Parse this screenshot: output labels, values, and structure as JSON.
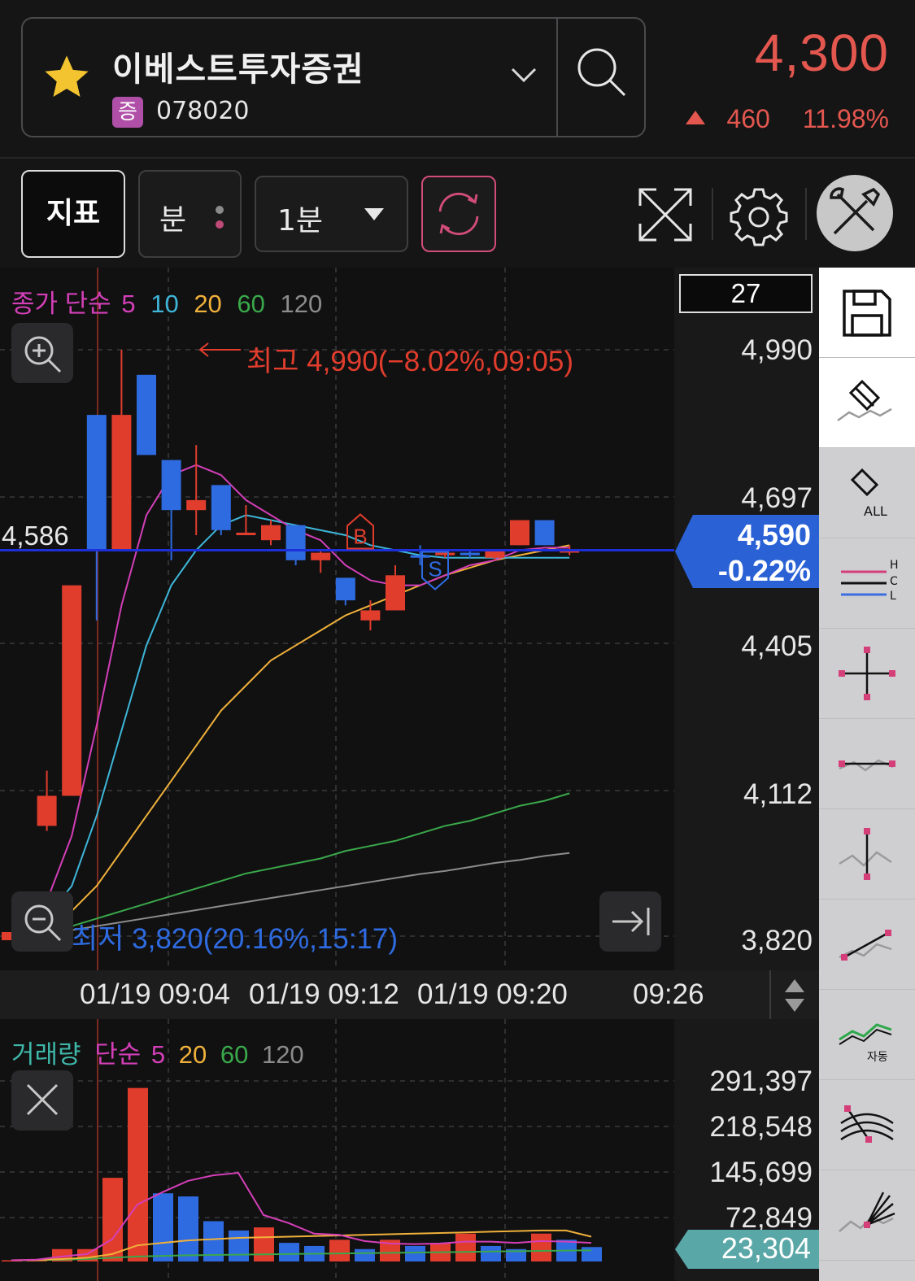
{
  "stock": {
    "name": "이베스트투자증권",
    "market_badge": "증",
    "code": "078020",
    "price": "4,300",
    "change": "460",
    "change_pct": "11.98%",
    "color_up": "#e4574f"
  },
  "toolbar": {
    "indicator_label": "지표",
    "period_label": "분",
    "interval_label": "1분"
  },
  "main_chart": {
    "legend": {
      "base": "종가 단순",
      "ma5": "5",
      "ma10": "10",
      "ma20": "20",
      "ma60": "60",
      "ma120": "120"
    },
    "count_box": "27",
    "y_labels": [
      "4,990",
      "4,697",
      "4,405",
      "4,112",
      "3,820"
    ],
    "current_price": "4,590",
    "current_pct": "-0.22%",
    "left_price": "4,586",
    "high_note": "최고 4,990(−8.02%,09:05)",
    "low_note": "최저 3,820(20.16%,15:17)",
    "buy_marker": "B",
    "sell_marker": "S",
    "x_labels": [
      "01/19 09:04",
      "01/19 09:12",
      "01/19 09:20",
      "09:26"
    ]
  },
  "volume_chart": {
    "legend": {
      "base": "거래량",
      "simple": "단순",
      "ma5": "5",
      "ma20": "20",
      "ma60": "60",
      "ma120": "120"
    },
    "y_labels": [
      "291,397",
      "218,548",
      "145,699",
      "72,849"
    ],
    "current_volume": "23,304"
  },
  "colors": {
    "up": "#e13d2d",
    "down": "#2f6be0",
    "ma5": "#d43fb8",
    "ma10": "#3eb6d8",
    "ma20": "#f0b13a",
    "ma60": "#3aa84a",
    "ma120": "#8c8c8c"
  },
  "chart_data": [
    {
      "type": "candlestick",
      "title": "",
      "ylim": [
        3820,
        4990
      ],
      "x": [
        "01/19 09:04",
        "01/19 09:12",
        "01/19 09:20",
        "09:26"
      ],
      "candles": [
        {
          "o": 3820,
          "h": 3830,
          "l": 3810,
          "c": 3825
        },
        {
          "o": 4040,
          "h": 4150,
          "l": 4030,
          "c": 4100
        },
        {
          "o": 4100,
          "h": 4520,
          "l": 4100,
          "c": 4520
        },
        {
          "o": 4860,
          "h": 4860,
          "l": 4450,
          "c": 4590
        },
        {
          "o": 4590,
          "h": 4990,
          "l": 4590,
          "c": 4860
        },
        {
          "o": 4940,
          "h": 4940,
          "l": 4780,
          "c": 4780
        },
        {
          "o": 4770,
          "h": 4770,
          "l": 4570,
          "c": 4670
        },
        {
          "o": 4670,
          "h": 4800,
          "l": 4620,
          "c": 4690
        },
        {
          "o": 4720,
          "h": 4720,
          "l": 4620,
          "c": 4630
        },
        {
          "o": 4620,
          "h": 4680,
          "l": 4620,
          "c": 4625
        },
        {
          "o": 4610,
          "h": 4650,
          "l": 4600,
          "c": 4640
        },
        {
          "o": 4640,
          "h": 4640,
          "l": 4560,
          "c": 4570
        },
        {
          "o": 4570,
          "h": 4590,
          "l": 4545,
          "c": 4585
        },
        {
          "o": 4535,
          "h": 4535,
          "l": 4480,
          "c": 4490
        },
        {
          "o": 4450,
          "h": 4490,
          "l": 4430,
          "c": 4470
        },
        {
          "o": 4470,
          "h": 4560,
          "l": 4470,
          "c": 4540
        },
        {
          "o": 4580,
          "h": 4600,
          "l": 4560,
          "c": 4575
        },
        {
          "o": 4580,
          "h": 4590,
          "l": 4575,
          "c": 4585
        },
        {
          "o": 4585,
          "h": 4590,
          "l": 4575,
          "c": 4580
        },
        {
          "o": 4575,
          "h": 4590,
          "l": 4570,
          "c": 4590
        },
        {
          "o": 4600,
          "h": 4650,
          "l": 4600,
          "c": 4650
        },
        {
          "o": 4650,
          "h": 4650,
          "l": 4600,
          "c": 4600
        },
        {
          "o": 4590,
          "h": 4600,
          "l": 4580,
          "c": 4590
        }
      ],
      "ma5": [
        3825,
        3890,
        4020,
        4240,
        4480,
        4660,
        4740,
        4760,
        4740,
        4690,
        4660,
        4630,
        4610,
        4560,
        4530,
        4520,
        4520,
        4540,
        4560,
        4570,
        4590,
        4595,
        4595
      ],
      "ma10": [
        3825,
        3860,
        3920,
        4060,
        4230,
        4400,
        4520,
        4590,
        4640,
        4660,
        4650,
        4640,
        4630,
        4620,
        4600,
        4590,
        4580,
        4575,
        4575,
        4575,
        4575,
        4575,
        4575
      ],
      "ma20": [
        3825,
        3840,
        3870,
        3920,
        3990,
        4060,
        4130,
        4200,
        4270,
        4320,
        4370,
        4400,
        4430,
        4460,
        4480,
        4500,
        4520,
        4540,
        4555,
        4570,
        4580,
        4590,
        4600
      ],
      "ma60": [
        3825,
        3830,
        3840,
        3855,
        3870,
        3885,
        3900,
        3915,
        3930,
        3945,
        3955,
        3965,
        3975,
        3990,
        4000,
        4010,
        4025,
        4040,
        4050,
        4065,
        4080,
        4090,
        4105
      ],
      "ma120": [
        3825,
        3828,
        3832,
        3840,
        3848,
        3856,
        3864,
        3872,
        3880,
        3888,
        3896,
        3904,
        3912,
        3920,
        3928,
        3936,
        3944,
        3950,
        3958,
        3966,
        3972,
        3980,
        3986
      ]
    },
    {
      "type": "bar",
      "title": "거래량",
      "ylim": [
        0,
        291397
      ],
      "values": [
        2000,
        4000,
        20000,
        20000,
        135000,
        280000,
        110000,
        105000,
        65000,
        50000,
        55000,
        30000,
        25000,
        35000,
        20000,
        35000,
        25000,
        30000,
        45000,
        25000,
        20000,
        45000,
        35000,
        23304
      ],
      "up": [
        true,
        true,
        true,
        true,
        true,
        true,
        false,
        false,
        false,
        false,
        true,
        false,
        false,
        true,
        false,
        true,
        false,
        true,
        true,
        false,
        false,
        true,
        false,
        false
      ],
      "ma5": [
        2000,
        3000,
        8000,
        12000,
        36000,
        92000,
        112000,
        130000,
        139000,
        143000,
        75000,
        62000,
        45000,
        43000,
        33000,
        29000,
        28000,
        29000,
        32000,
        32000,
        30000,
        33000,
        32000,
        30000
      ],
      "ma20": [
        2000,
        2500,
        4000,
        6000,
        12000,
        26000,
        30000,
        34000,
        36000,
        38000,
        39000,
        40000,
        41000,
        42000,
        43000,
        44000,
        45000,
        46000,
        47000,
        48000,
        49000,
        50000,
        50000,
        40000
      ],
      "ma60": [
        2000,
        2200,
        3000,
        4000,
        6000,
        8000,
        9000,
        10000,
        10500,
        11000,
        11500,
        12000,
        12500,
        13000,
        13500,
        14000,
        14500,
        15000,
        15500,
        16000,
        16500,
        17000,
        17500,
        18000
      ]
    }
  ]
}
